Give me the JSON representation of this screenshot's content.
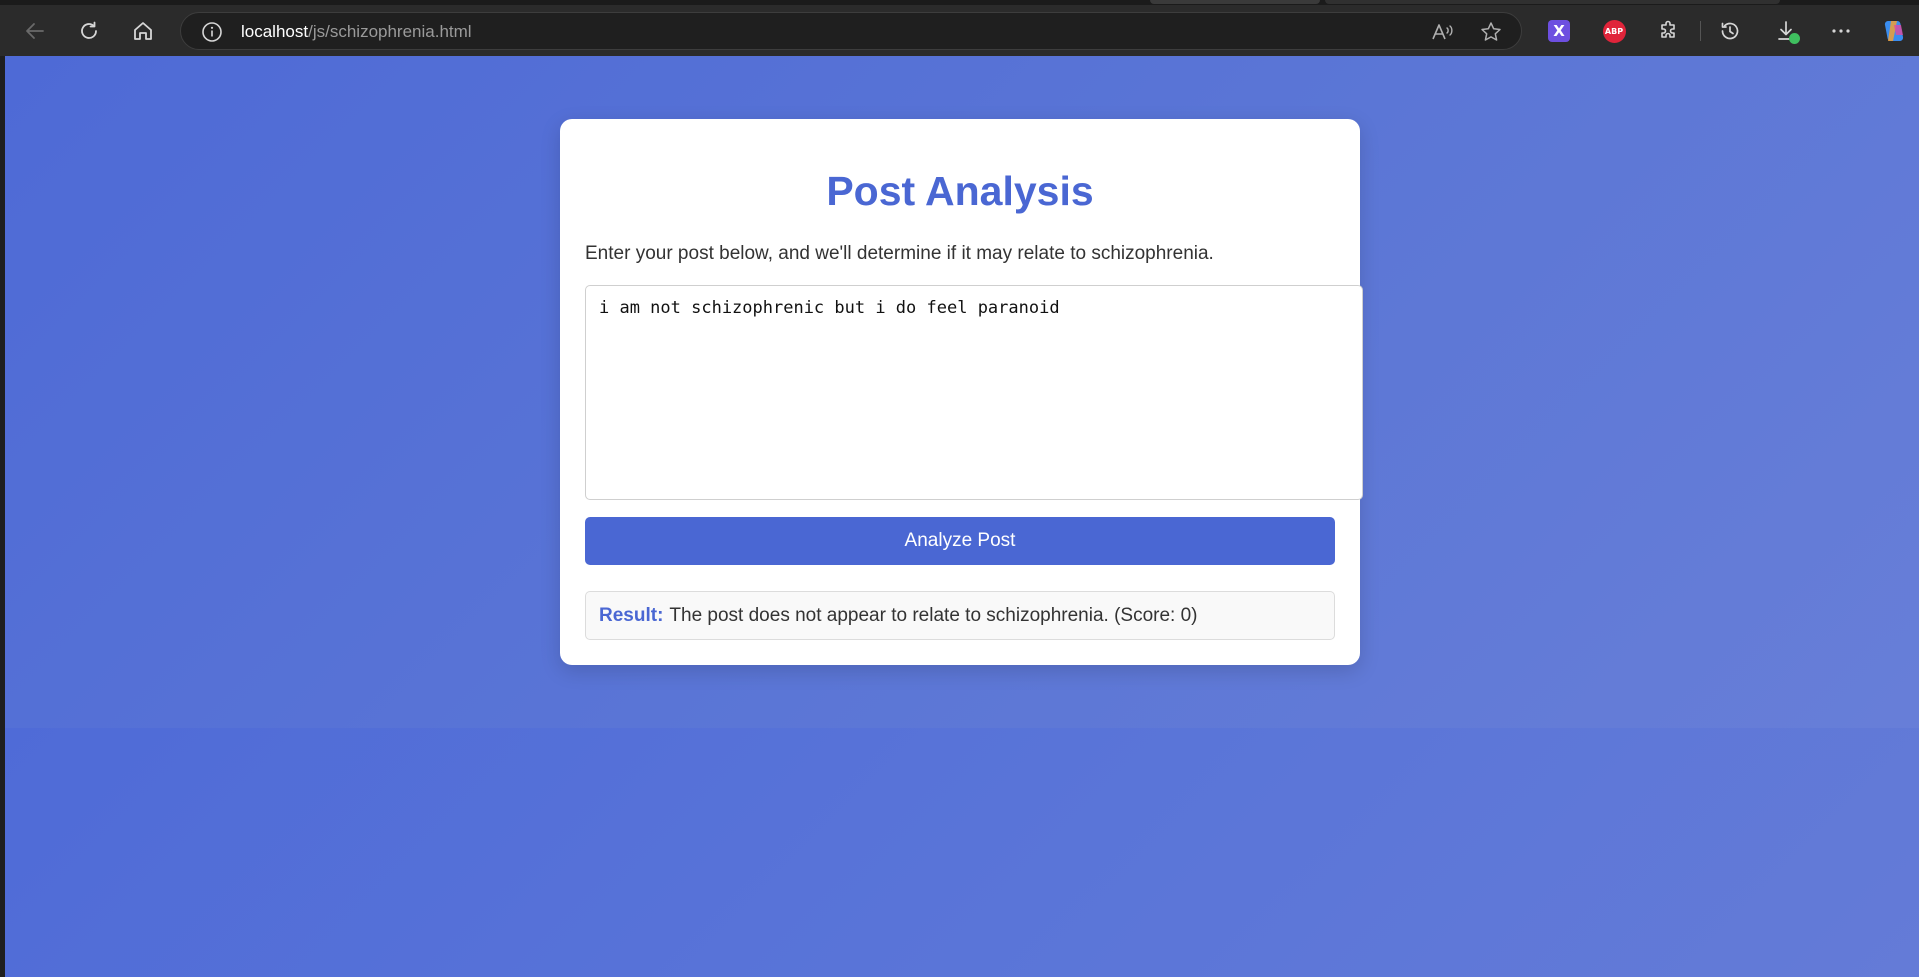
{
  "browser": {
    "url_host": "localhost",
    "url_path": "/js/schizophrenia.html",
    "extensions": {
      "x_label": "X",
      "abp_label": "ABP"
    }
  },
  "page": {
    "title": "Post Analysis",
    "description": "Enter your post below, and we'll determine if it may relate to schizophrenia.",
    "post_text": "i am not schizophrenic but i do feel paranoid",
    "analyze_button": "Analyze Post",
    "result_label": "Result:",
    "result_text": "The post does not appear to relate to schizophrenia. (Score: 0)"
  },
  "colors": {
    "accent": "#4a67d3",
    "background_gradient_start": "#4e6ad6",
    "background_gradient_end": "#6a80d8",
    "card": "#ffffff"
  },
  "icons": [
    "back-icon",
    "refresh-icon",
    "home-icon",
    "info-icon",
    "read-aloud-icon",
    "favorite-star-icon",
    "x-extension-icon",
    "adblock-plus-icon",
    "extensions-puzzle-icon",
    "history-icon",
    "downloads-icon",
    "more-menu-icon",
    "copilot-icon"
  ]
}
